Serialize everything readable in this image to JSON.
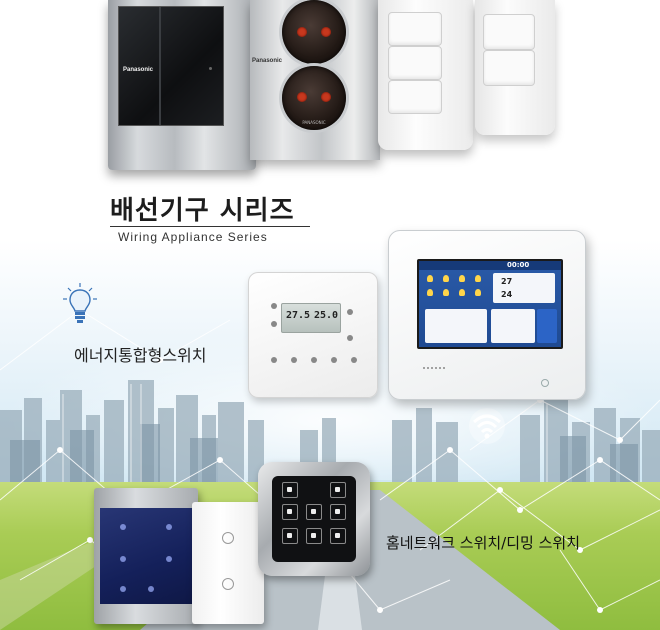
{
  "top_products": {
    "brand_left": "Panasonic",
    "brand_socket": "Panasonic",
    "socket_label": "PANASONIC"
  },
  "series": {
    "title": "배선기구 시리즈",
    "subtitle": "Wiring Appliance Series"
  },
  "energy": {
    "label": "에너지통합형스위치",
    "thermostat": {
      "current_temp": "27.5",
      "set_temp": "25.0"
    },
    "panel": {
      "time": "00:00",
      "temp_main": "27",
      "temp_sub": "24"
    }
  },
  "network": {
    "label": "홈네트워크 스위치/디밍 스위치"
  },
  "colors": {
    "accent_blue": "#1f4a92",
    "grass": "#a9cc55",
    "title": "#1d1d1d"
  }
}
